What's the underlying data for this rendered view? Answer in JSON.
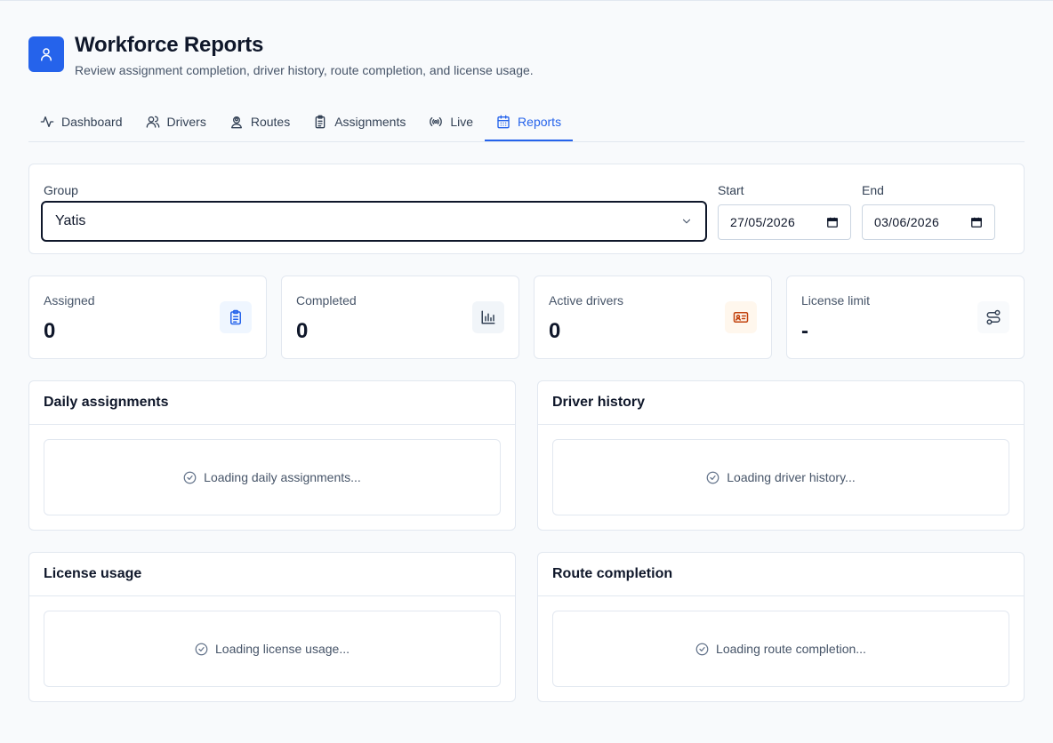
{
  "header": {
    "title": "Workforce Reports",
    "subtitle": "Review assignment completion, driver history, route completion, and license usage.",
    "icon": "user-icon"
  },
  "tabs": [
    {
      "label": "Dashboard",
      "icon": "activity-icon",
      "active": false
    },
    {
      "label": "Drivers",
      "icon": "users-icon",
      "active": false
    },
    {
      "label": "Routes",
      "icon": "map-pin-user-icon",
      "active": false
    },
    {
      "label": "Assignments",
      "icon": "clipboard-list-icon",
      "active": false
    },
    {
      "label": "Live",
      "icon": "radio-icon",
      "active": false
    },
    {
      "label": "Reports",
      "icon": "calendar-icon",
      "active": true
    }
  ],
  "filters": {
    "group_label": "Group",
    "group_value": "Yatis",
    "start_label": "Start",
    "start_value": "27/05/2026",
    "end_label": "End",
    "end_value": "03/06/2026"
  },
  "stats": [
    {
      "label": "Assigned",
      "value": "0",
      "icon": "clipboard-list-icon",
      "color": "#2563eb",
      "bg": "#eff6ff"
    },
    {
      "label": "Completed",
      "value": "0",
      "icon": "bar-chart-icon",
      "color": "#334155",
      "bg": "#f1f5f9"
    },
    {
      "label": "Active drivers",
      "value": "0",
      "icon": "id-card-icon",
      "color": "#c2410c",
      "bg": "#fff7ed"
    },
    {
      "label": "License limit",
      "value": "-",
      "icon": "route-icon",
      "color": "#334155",
      "bg": "#f8fafc"
    }
  ],
  "panels": [
    {
      "title": "Daily assignments",
      "loading": "Loading daily assignments..."
    },
    {
      "title": "Driver history",
      "loading": "Loading driver history..."
    },
    {
      "title": "License usage",
      "loading": "Loading license usage..."
    },
    {
      "title": "Route completion",
      "loading": "Loading route completion..."
    }
  ],
  "colors": {
    "accent": "#2563eb",
    "background": "#f8fafc",
    "border": "#e2e8f0",
    "text": "#0f172a",
    "muted": "#475569"
  }
}
